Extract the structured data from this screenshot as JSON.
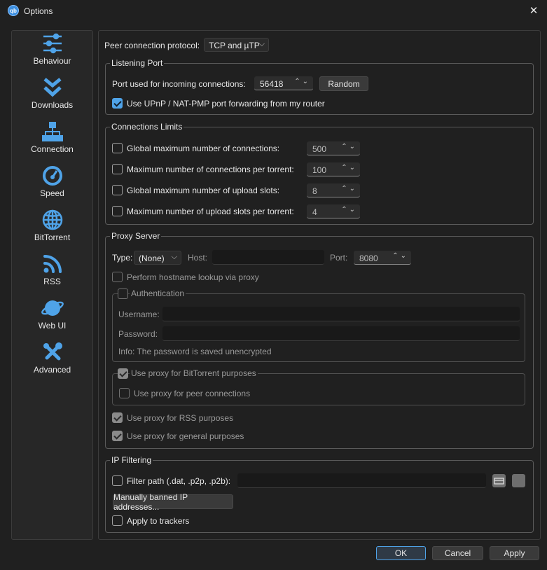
{
  "window": {
    "title": "Options",
    "app_icon": "qb"
  },
  "sidebar": {
    "items": [
      {
        "label": "Behaviour",
        "icon": "sliders-icon"
      },
      {
        "label": "Downloads",
        "icon": "double-chevron-down-icon"
      },
      {
        "label": "Connection",
        "icon": "network-icon"
      },
      {
        "label": "Speed",
        "icon": "gauge-icon"
      },
      {
        "label": "BitTorrent",
        "icon": "globe-icon"
      },
      {
        "label": "RSS",
        "icon": "rss-icon"
      },
      {
        "label": "Web UI",
        "icon": "planet-icon"
      },
      {
        "label": "Advanced",
        "icon": "tools-icon"
      }
    ]
  },
  "protocol": {
    "label": "Peer connection protocol:",
    "value": "TCP and µTP"
  },
  "listening": {
    "title": "Listening Port",
    "port_label": "Port used for incoming connections:",
    "port_value": "56418",
    "random_label": "Random",
    "upnp_label": "Use UPnP / NAT-PMP port forwarding from my router"
  },
  "limits": {
    "title": "Connections Limits",
    "rows": [
      {
        "label": "Global maximum number of connections:",
        "value": "500"
      },
      {
        "label": "Maximum number of connections per torrent:",
        "value": "100"
      },
      {
        "label": "Global maximum number of upload slots:",
        "value": "8"
      },
      {
        "label": "Maximum number of upload slots per torrent:",
        "value": "4"
      }
    ]
  },
  "proxy": {
    "title": "Proxy Server",
    "type_label": "Type:",
    "type_value": "(None)",
    "host_label": "Host:",
    "port_label": "Port:",
    "port_value": "8080",
    "hostname_lookup": "Perform hostname lookup via proxy",
    "auth_title": "Authentication",
    "username_label": "Username:",
    "password_label": "Password:",
    "info": "Info: The password is saved unencrypted",
    "bittorrent_title": "Use proxy for BitTorrent purposes",
    "peer_label": "Use proxy for peer connections",
    "rss_label": "Use proxy for RSS purposes",
    "general_label": "Use proxy for general purposes"
  },
  "ipfilter": {
    "title": "IP Filtering",
    "path_label": "Filter path (.dat, .p2p, .p2b):",
    "banned_label": "Manually banned IP addresses...",
    "trackers_label": "Apply to trackers"
  },
  "footer": {
    "ok": "OK",
    "cancel": "Cancel",
    "apply": "Apply"
  },
  "colors": {
    "accent": "#4fa3e8",
    "background": "#202020",
    "panel": "#272727"
  }
}
